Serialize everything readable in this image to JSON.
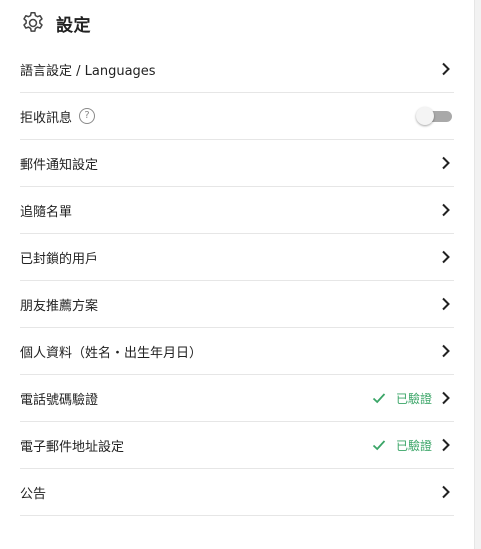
{
  "header": {
    "title": "設定",
    "icon": "gear-icon"
  },
  "colors": {
    "accent_green": "#3aa567",
    "divider": "#e6e6e6",
    "toggle_track": "#a9a9a9"
  },
  "settings": {
    "items": [
      {
        "label": "語言設定 / Languages"
      },
      {
        "label": "拒收訊息",
        "help_icon": "question-icon",
        "toggle_on": false
      },
      {
        "label": "郵件通知設定"
      },
      {
        "label": "追隨名單"
      },
      {
        "label": "已封鎖的用戶"
      },
      {
        "label": "朋友推薦方案"
      },
      {
        "label": "個人資料（姓名・出生年月日）"
      },
      {
        "label": "電話號碼驗證",
        "status": "已驗證"
      },
      {
        "label": "電子郵件地址設定",
        "status": "已驗證"
      },
      {
        "label": "公告"
      }
    ]
  }
}
